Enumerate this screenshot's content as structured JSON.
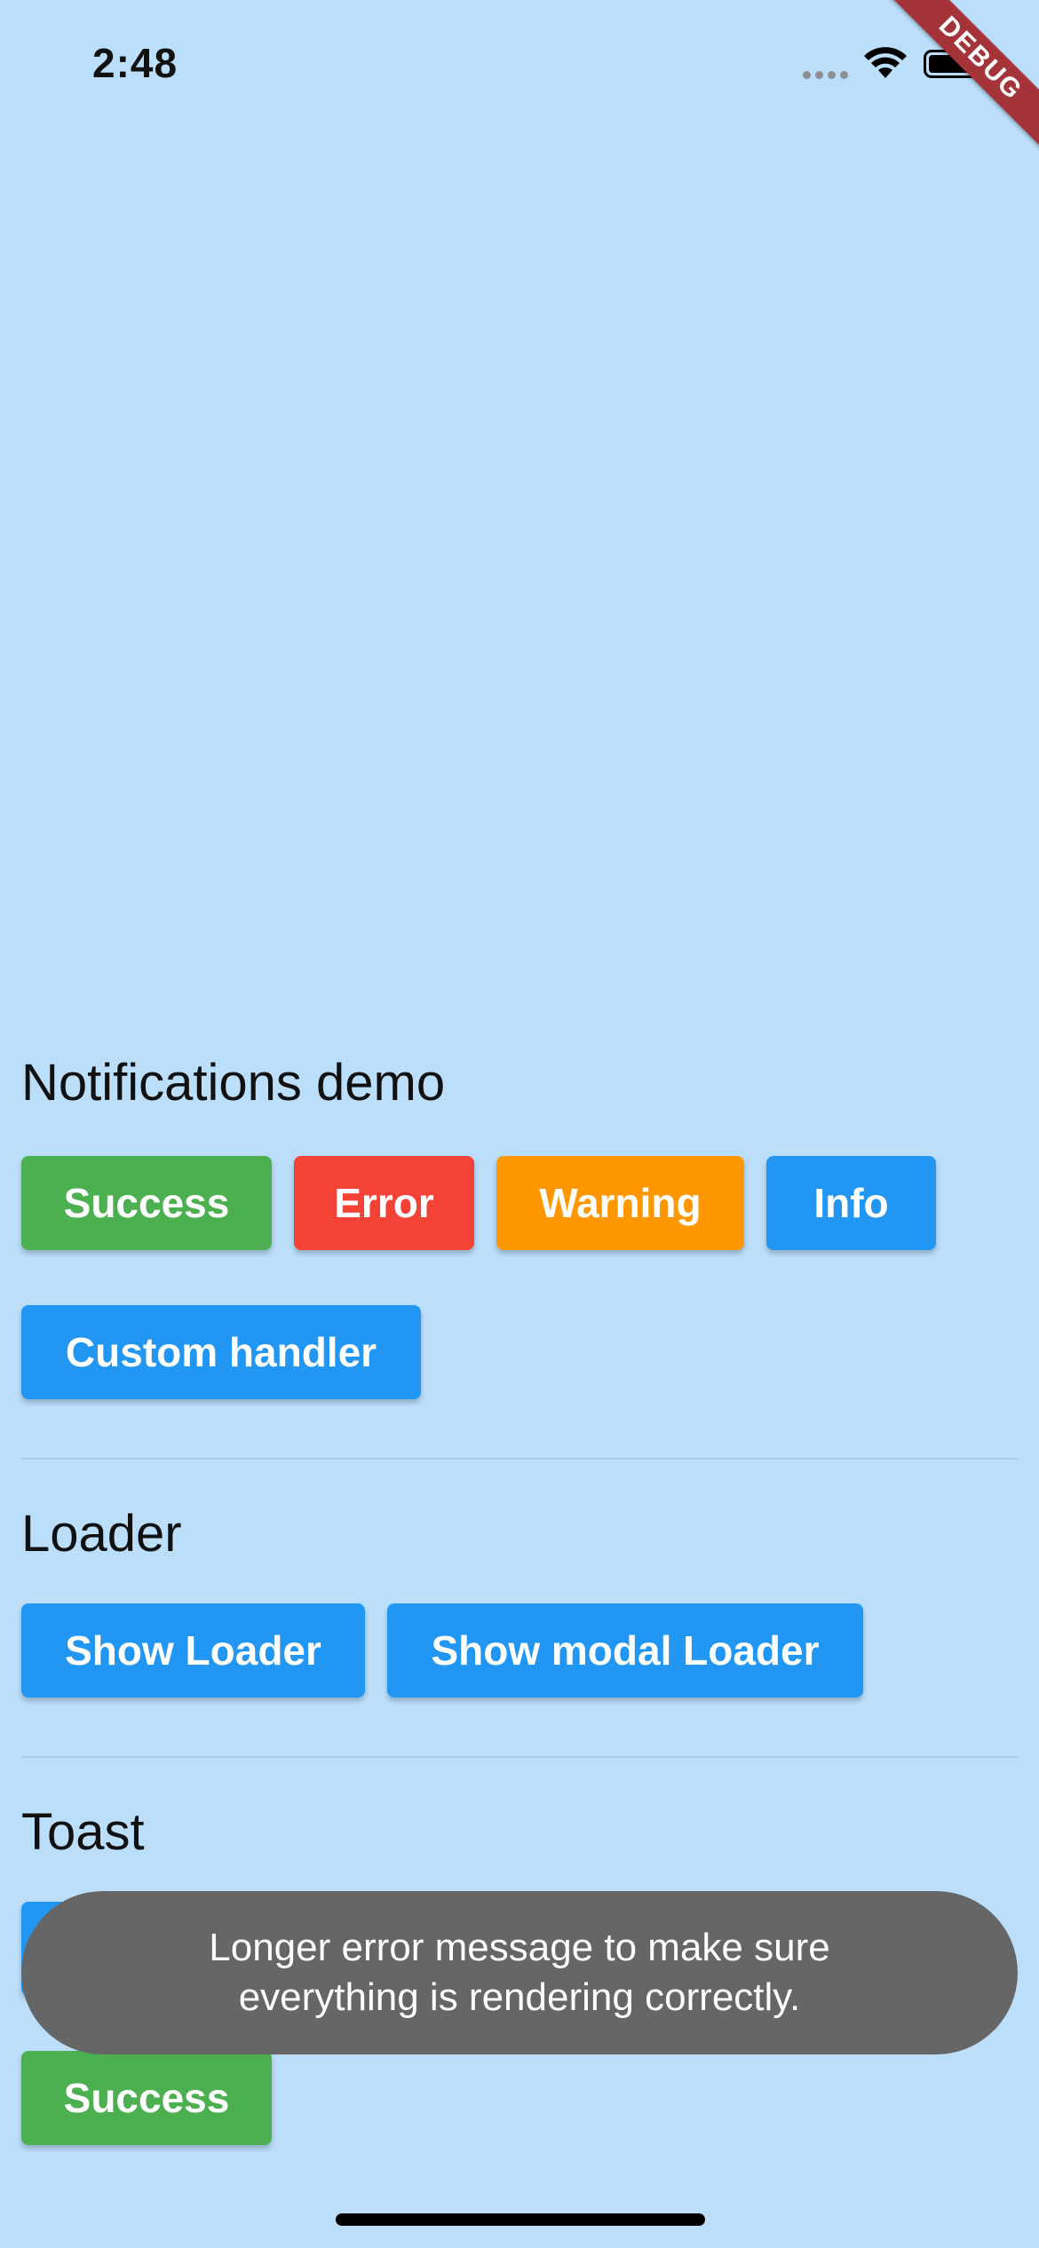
{
  "status_bar": {
    "time": "2:48",
    "icons": [
      "signal-dots-icon",
      "wifi-icon",
      "battery-icon"
    ]
  },
  "debug_banner": {
    "label": "DEBUG",
    "color": "#a4343a"
  },
  "notifications": {
    "title": "Notifications demo",
    "buttons": {
      "success": "Success",
      "error": "Error",
      "warning": "Warning",
      "info": "Info",
      "custom": "Custom handler"
    }
  },
  "loader": {
    "title": "Loader",
    "buttons": {
      "show_loader": "Show Loader",
      "show_modal_loader": "Show modal Loader"
    }
  },
  "toast": {
    "title": "Toast",
    "buttons": {
      "success": "Success"
    },
    "message": "Longer error message to make sure everything is rendering correctly."
  },
  "colors": {
    "background": "#bbdefb",
    "success": "#4caf50",
    "error": "#f44336",
    "warning": "#ff9800",
    "info": "#2196f3",
    "toast": "#666666"
  }
}
